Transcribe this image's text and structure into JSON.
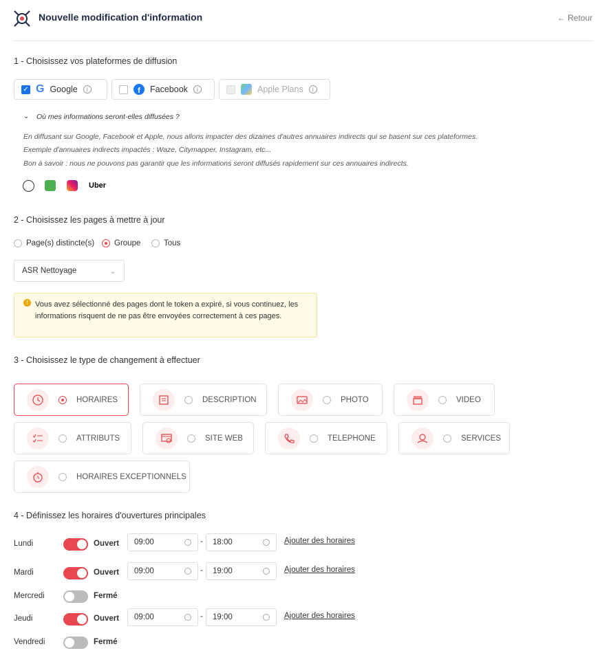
{
  "header": {
    "title": "Nouvelle modification d'information",
    "back": "← Retour"
  },
  "section1": {
    "title": "1 - Choisissez vos plateformes de diffusion",
    "platforms": [
      {
        "label": "Google",
        "checked": true
      },
      {
        "label": "Facebook",
        "checked": false
      },
      {
        "label": "Apple Plans",
        "checked": false,
        "disabled": true
      }
    ],
    "toggle_label": "Où mes informations seront-elles diffusées ?",
    "line1": "En diffusant sur Google, Facebook et Apple, nous allons impacter des dizaines d'autres annuaires indirects qui se basent sur ces plateformes.",
    "line2": "Exemple d'annuaires indirects impactés : Waze, Citymapper, Instagram, etc...",
    "line3": "Bon à savoir : nous ne pouvons pas garantir que les informations seront diffusés rapidement sur ces annuaires indirects.",
    "uber": "Uber"
  },
  "section2": {
    "title": "2 - Choisissez les pages à mettre à jour",
    "options": [
      "Page(s) distincte(s)",
      "Groupe",
      "Tous"
    ],
    "selected": "Groupe",
    "select_value": "ASR Nettoyage",
    "warning": "Vous avez sélectionné des pages dont le token a expiré, si vous continuez, les informations risquent de ne pas être envoyées correctement à ces pages."
  },
  "section3": {
    "title": "3 - Choisissez le type de changement à effectuer",
    "types": [
      "HORAIRES",
      "DESCRIPTION",
      "PHOTO",
      "VIDEO",
      "ATTRIBUTS",
      "SITE WEB",
      "TELEPHONE",
      "SERVICES",
      "HORAIRES EXCEPTIONNELS"
    ],
    "selected": "HORAIRES"
  },
  "section4": {
    "title": "4 - Définissez les horaires d'ouvertures principales",
    "add_label": "Ajouter des horaires",
    "days": [
      {
        "day": "Lundi",
        "state": "Ouvert",
        "from": "09:00",
        "to": "18:00"
      },
      {
        "day": "Mardi",
        "state": "Ouvert",
        "from": "09:00",
        "to": "19:00"
      },
      {
        "day": "Mercredi",
        "state": "Fermé"
      },
      {
        "day": "Jeudi",
        "state": "Ouvert",
        "from": "09:00",
        "to": "19:00"
      },
      {
        "day": "Vendredi",
        "state": "Fermé"
      }
    ]
  },
  "colors": {
    "accent": "#e8474f",
    "google_blue": "#1a73e8",
    "warning_bg": "#fffbe6"
  }
}
